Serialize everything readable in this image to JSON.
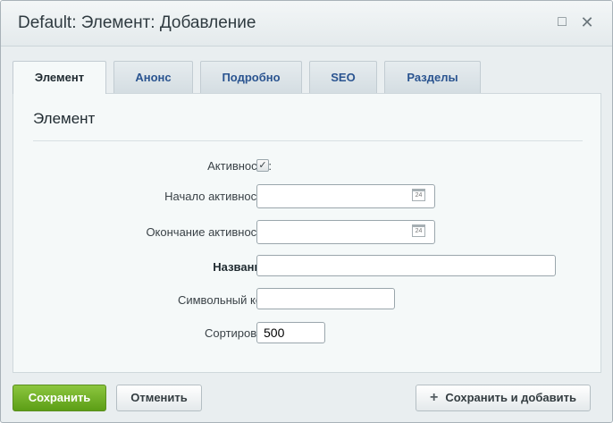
{
  "window": {
    "title": "Default: Элемент: Добавление",
    "maximize_icon": "□",
    "close_icon": "✕"
  },
  "tabs": [
    {
      "label": "Элемент",
      "active": true
    },
    {
      "label": "Анонс",
      "active": false
    },
    {
      "label": "Подробно",
      "active": false
    },
    {
      "label": "SEO",
      "active": false
    },
    {
      "label": "Разделы",
      "active": false
    }
  ],
  "section": {
    "title": "Элемент"
  },
  "form": {
    "active": {
      "label": "Активность:",
      "checked": true
    },
    "active_from": {
      "label": "Начало активности:",
      "value": ""
    },
    "active_to": {
      "label": "Окончание активности:",
      "value": ""
    },
    "name": {
      "label": "Название:",
      "value": ""
    },
    "code": {
      "label": "Символьный код:",
      "value": ""
    },
    "sort": {
      "label": "Сортировка:",
      "value": "500"
    },
    "calendar_day": "24"
  },
  "buttons": {
    "save": "Сохранить",
    "cancel": "Отменить",
    "save_add": "Сохранить и добавить",
    "save_add_icon": "+"
  },
  "colors": {
    "accent_green": "#6aae23",
    "tab_text": "#2a5490"
  }
}
